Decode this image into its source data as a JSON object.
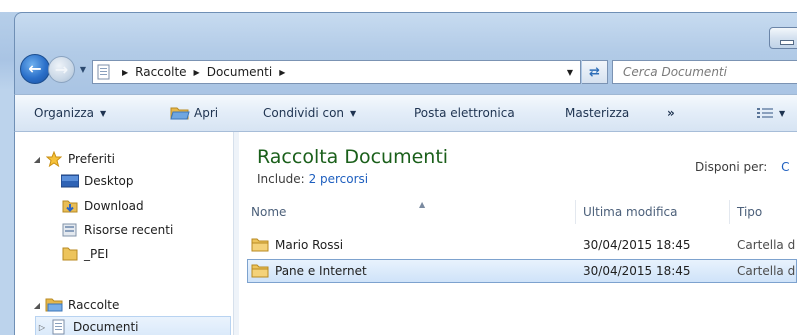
{
  "window": {
    "accent": "#a9c4e4"
  },
  "navigation": {
    "breadcrumb": [
      "Raccolte",
      "Documenti"
    ],
    "search_placeholder": "Cerca Documenti"
  },
  "command_bar": {
    "organize": "Organizza",
    "open": "Apri",
    "share": "Condividi con",
    "email": "Posta elettronica",
    "burn": "Masterizza",
    "more": "»"
  },
  "sidebar": {
    "favorites_label": "Preferiti",
    "favorites": [
      {
        "label": "Desktop",
        "icon": "desktop-icon"
      },
      {
        "label": "Download",
        "icon": "download-folder-icon"
      },
      {
        "label": "Risorse recenti",
        "icon": "recent-places-icon"
      },
      {
        "label": "_PEI",
        "icon": "folder-icon"
      }
    ],
    "libraries_label": "Raccolte",
    "libraries": [
      {
        "label": "Documenti",
        "icon": "documents-library-icon",
        "selected": true
      }
    ]
  },
  "library": {
    "title": "Raccolta Documenti",
    "include_label": "Include:",
    "include_link": "2 percorsi",
    "arrange_label": "Disponi per:",
    "arrange_value": "C"
  },
  "columns": {
    "name": "Nome",
    "modified": "Ultima modifica",
    "type": "Tipo"
  },
  "files": [
    {
      "name": "Mario Rossi",
      "modified": "30/04/2015 18:45",
      "type": "Cartella d",
      "selected": false
    },
    {
      "name": "Pane e Internet",
      "modified": "30/04/2015 18:45",
      "type": "Cartella d",
      "selected": true
    }
  ]
}
